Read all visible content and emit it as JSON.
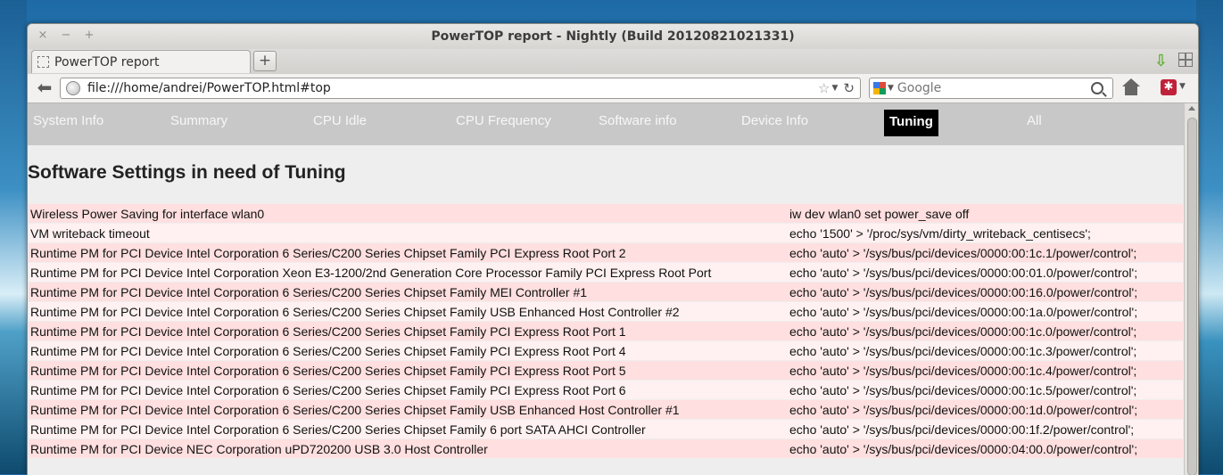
{
  "window": {
    "title": "PowerTOP report - Nightly (Build 20120821021331)",
    "controls": {
      "close": "×",
      "minimize": "−",
      "maximize": "+"
    }
  },
  "tabs": [
    {
      "label": "PowerTOP report"
    }
  ],
  "new_tab_label": "+",
  "toolbar": {
    "url": "file:///home/andrei/PowerTOP.html#top",
    "search_placeholder": "Google",
    "icons": [
      "back-icon",
      "globe-icon",
      "star-icon",
      "reload-icon",
      "google-icon",
      "search-icon",
      "home-icon",
      "addon-icon",
      "download-icon",
      "tab-groups-icon"
    ],
    "addon_glyph": "✱",
    "download_glyph": "⇩"
  },
  "report": {
    "nav": [
      {
        "label": "System Info",
        "active": false
      },
      {
        "label": "Summary",
        "active": false
      },
      {
        "label": "CPU Idle",
        "active": false
      },
      {
        "label": "CPU Frequency",
        "active": false
      },
      {
        "label": "Software info",
        "active": false
      },
      {
        "label": "Device Info",
        "active": false
      },
      {
        "label": "Tuning",
        "active": true
      },
      {
        "label": "All",
        "active": false
      }
    ],
    "section_title": "Software Settings in need of Tuning",
    "rows": [
      {
        "description": "Wireless Power Saving for interface wlan0",
        "command": "iw dev wlan0 set power_save off"
      },
      {
        "description": "VM writeback timeout",
        "command": "echo '1500' > '/proc/sys/vm/dirty_writeback_centisecs';"
      },
      {
        "description": "Runtime PM for PCI Device Intel Corporation 6 Series/C200 Series Chipset Family PCI Express Root Port 2",
        "command": "echo 'auto' > '/sys/bus/pci/devices/0000:00:1c.1/power/control';"
      },
      {
        "description": "Runtime PM for PCI Device Intel Corporation Xeon E3-1200/2nd Generation Core Processor Family PCI Express Root Port",
        "command": "echo 'auto' > '/sys/bus/pci/devices/0000:00:01.0/power/control';"
      },
      {
        "description": "Runtime PM for PCI Device Intel Corporation 6 Series/C200 Series Chipset Family MEI Controller #1",
        "command": "echo 'auto' > '/sys/bus/pci/devices/0000:00:16.0/power/control';"
      },
      {
        "description": "Runtime PM for PCI Device Intel Corporation 6 Series/C200 Series Chipset Family USB Enhanced Host Controller #2",
        "command": "echo 'auto' > '/sys/bus/pci/devices/0000:00:1a.0/power/control';"
      },
      {
        "description": "Runtime PM for PCI Device Intel Corporation 6 Series/C200 Series Chipset Family PCI Express Root Port 1",
        "command": "echo 'auto' > '/sys/bus/pci/devices/0000:00:1c.0/power/control';"
      },
      {
        "description": "Runtime PM for PCI Device Intel Corporation 6 Series/C200 Series Chipset Family PCI Express Root Port 4",
        "command": "echo 'auto' > '/sys/bus/pci/devices/0000:00:1c.3/power/control';"
      },
      {
        "description": "Runtime PM for PCI Device Intel Corporation 6 Series/C200 Series Chipset Family PCI Express Root Port 5",
        "command": "echo 'auto' > '/sys/bus/pci/devices/0000:00:1c.4/power/control';"
      },
      {
        "description": "Runtime PM for PCI Device Intel Corporation 6 Series/C200 Series Chipset Family PCI Express Root Port 6",
        "command": "echo 'auto' > '/sys/bus/pci/devices/0000:00:1c.5/power/control';"
      },
      {
        "description": "Runtime PM for PCI Device Intel Corporation 6 Series/C200 Series Chipset Family USB Enhanced Host Controller #1",
        "command": "echo 'auto' > '/sys/bus/pci/devices/0000:00:1d.0/power/control';"
      },
      {
        "description": "Runtime PM for PCI Device Intel Corporation 6 Series/C200 Series Chipset Family 6 port SATA AHCI Controller",
        "command": "echo 'auto' > '/sys/bus/pci/devices/0000:00:1f.2/power/control';"
      },
      {
        "description": "Runtime PM for PCI Device NEC Corporation uPD720200 USB 3.0 Host Controller",
        "command": "echo 'auto' > '/sys/bus/pci/devices/0000:04:00.0/power/control';"
      }
    ]
  },
  "colors": {
    "nav_bg": "#c8c8c8",
    "nav_active_bg": "#000000",
    "row_odd": "#ffdfdf",
    "row_even": "#fff1f1",
    "page_bg": "#eeeeee"
  }
}
